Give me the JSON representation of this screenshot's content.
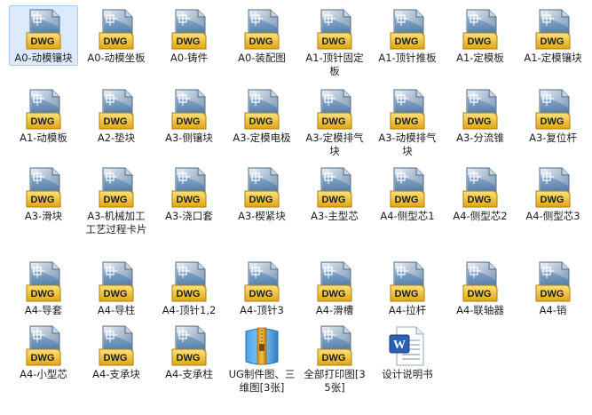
{
  "folder": {
    "selected_index": 0,
    "items": [
      {
        "label": "A0-动模镶块",
        "icon": "dwg-icon"
      },
      {
        "label": "A0-动模坐板",
        "icon": "dwg-icon"
      },
      {
        "label": "A0-铸件",
        "icon": "dwg-icon"
      },
      {
        "label": "A0-装配图",
        "icon": "dwg-icon"
      },
      {
        "label": "A1-顶针固定板",
        "icon": "dwg-icon"
      },
      {
        "label": "A1-顶针推板",
        "icon": "dwg-icon"
      },
      {
        "label": "A1-定模板",
        "icon": "dwg-icon"
      },
      {
        "label": "A1-定模镶块",
        "icon": "dwg-icon"
      },
      {
        "label": "A1-动模板",
        "icon": "dwg-icon"
      },
      {
        "label": "A2-垫块",
        "icon": "dwg-icon"
      },
      {
        "label": "A3-侧镶块",
        "icon": "dwg-icon"
      },
      {
        "label": "A3-定模电极",
        "icon": "dwg-icon"
      },
      {
        "label": "A3-定模排气块",
        "icon": "dwg-icon"
      },
      {
        "label": "A3-动模排气块",
        "icon": "dwg-icon"
      },
      {
        "label": "A3-分流锥",
        "icon": "dwg-icon"
      },
      {
        "label": "A3-复位杆",
        "icon": "dwg-icon"
      },
      {
        "label": "A3-滑块",
        "icon": "dwg-icon"
      },
      {
        "label": "A3-机械加工工艺过程卡片",
        "icon": "dwg-icon"
      },
      {
        "label": "A3-浇口套",
        "icon": "dwg-icon"
      },
      {
        "label": "A3-楔紧块",
        "icon": "dwg-icon"
      },
      {
        "label": "A3-主型芯",
        "icon": "dwg-icon"
      },
      {
        "label": "A4-侧型芯1",
        "icon": "dwg-icon"
      },
      {
        "label": "A4-侧型芯2",
        "icon": "dwg-icon"
      },
      {
        "label": "A4-侧型芯3",
        "icon": "dwg-icon"
      },
      {
        "label": "A4-导套",
        "icon": "dwg-icon"
      },
      {
        "label": "A4-导柱",
        "icon": "dwg-icon"
      },
      {
        "label": "A4-顶针1,2",
        "icon": "dwg-icon"
      },
      {
        "label": "A4-顶针3",
        "icon": "dwg-icon"
      },
      {
        "label": "A4-滑槽",
        "icon": "dwg-icon"
      },
      {
        "label": "A4-拉杆",
        "icon": "dwg-icon"
      },
      {
        "label": "A4-联轴器",
        "icon": "dwg-icon"
      },
      {
        "label": "A4-销",
        "icon": "dwg-icon"
      },
      {
        "label": "A4-小型芯",
        "icon": "dwg-icon"
      },
      {
        "label": "A4-支承块",
        "icon": "dwg-icon"
      },
      {
        "label": "A4-支承柱",
        "icon": "dwg-icon"
      },
      {
        "label": "UG制件图、三维图[3张]",
        "icon": "archive-icon"
      },
      {
        "label": "全部打印图[35张]",
        "icon": "dwg-icon"
      },
      {
        "label": "设计说明书",
        "icon": "word-doc-icon"
      }
    ]
  },
  "icon_text": {
    "dwg": "DWG",
    "word": "W"
  }
}
